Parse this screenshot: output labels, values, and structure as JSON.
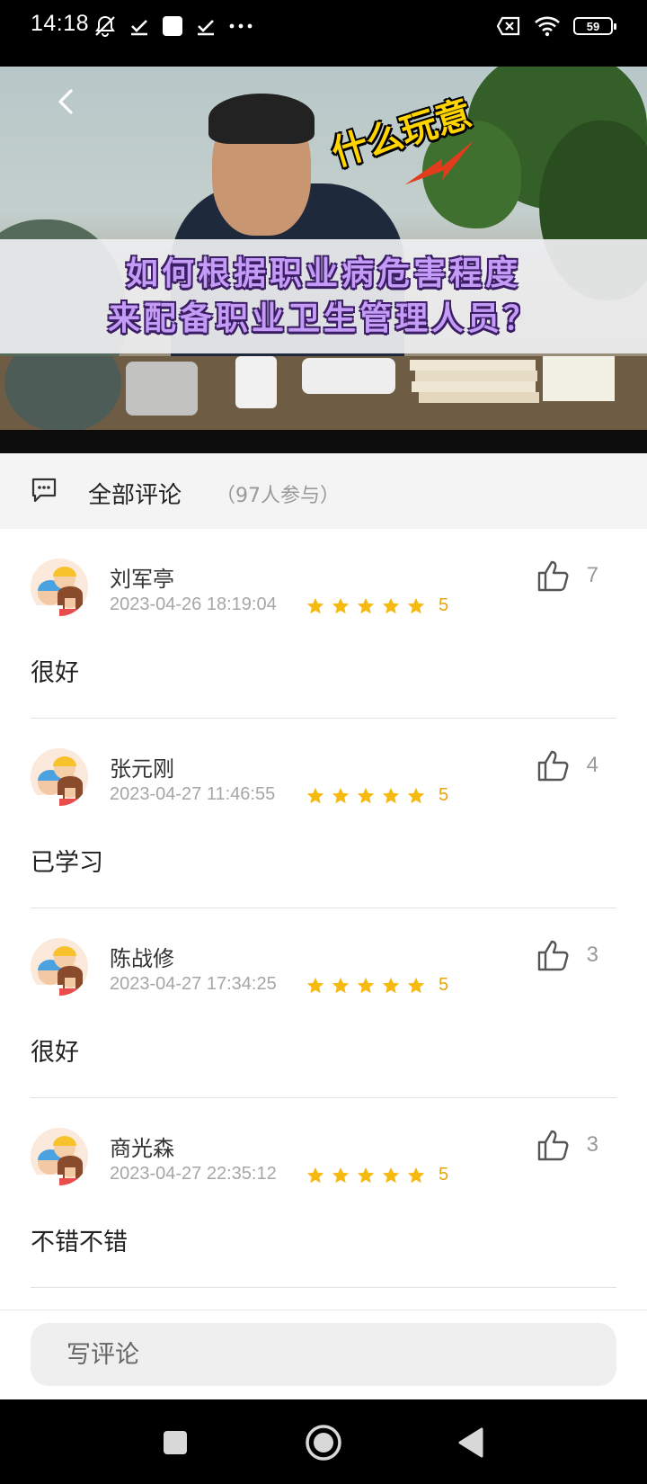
{
  "status_bar": {
    "time": "14:18",
    "battery": "59",
    "left_icons": [
      "mute-icon",
      "check-icon",
      "square-icon",
      "check-icon",
      "more-icon"
    ],
    "right_icons": [
      "sim-off-icon",
      "wifi-icon",
      "battery-icon"
    ]
  },
  "video": {
    "caption_line1": "如何根据职业病危害程度",
    "caption_line2": "来配备职业卫生管理人员？",
    "sticker_text": "什么玩意"
  },
  "comments_header": {
    "title": "全部评论",
    "count": "（97人参与）"
  },
  "comments": [
    {
      "name": "刘军亭",
      "time": "2023-04-26 18:19:04",
      "rating": 5,
      "rating_label": "5",
      "likes": "7",
      "text": "很好"
    },
    {
      "name": "张元刚",
      "time": "2023-04-27 11:46:55",
      "rating": 5,
      "rating_label": "5",
      "likes": "4",
      "text": "已学习"
    },
    {
      "name": "陈战修",
      "time": "2023-04-27 17:34:25",
      "rating": 5,
      "rating_label": "5",
      "likes": "3",
      "text": "很好"
    },
    {
      "name": "商光森",
      "time": "2023-04-27 22:35:12",
      "rating": 5,
      "rating_label": "5",
      "likes": "3",
      "text": "不错不错"
    }
  ],
  "bottom_bar": {
    "input_placeholder": "写评论"
  },
  "colors": {
    "star": "#f5b90f",
    "score": "#e8a50b",
    "caption_fill": "#c49bf6",
    "caption_outline": "#3a1d63"
  }
}
